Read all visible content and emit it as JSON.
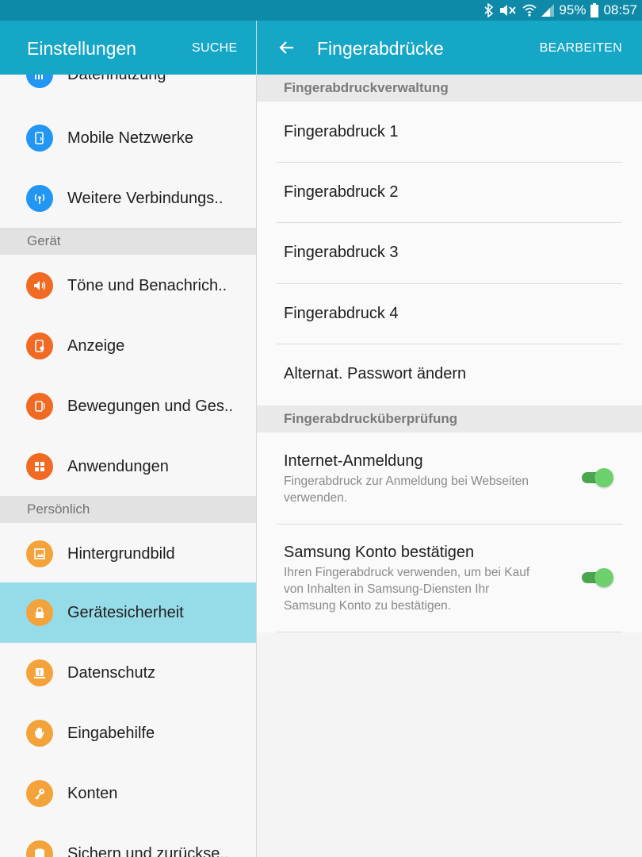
{
  "status_bar": {
    "battery": "95%",
    "time": "08:57",
    "icons": [
      "bluetooth-icon",
      "mute-icon",
      "wifi-icon",
      "signal-icon",
      "battery-icon"
    ]
  },
  "left_appbar": {
    "title": "Einstellungen",
    "search_label": "SUCHE"
  },
  "right_appbar": {
    "title": "Fingerabdrücke",
    "edit_label": "BEARBEITEN",
    "back_icon": "arrow-back-icon"
  },
  "sidebar": {
    "items_top": [
      {
        "label": "Datennutzung",
        "icon": "data-usage-icon",
        "color": "#2196f3"
      },
      {
        "label": "Mobile Netzwerke",
        "icon": "mobile-network-icon",
        "color": "#2196f3"
      },
      {
        "label": "Weitere Verbindungs..",
        "icon": "more-connections-icon",
        "color": "#2196f3"
      }
    ],
    "section_device": "Gerät",
    "items_device": [
      {
        "label": "Töne und Benachrich..",
        "icon": "sound-icon",
        "color": "#f06a23"
      },
      {
        "label": "Anzeige",
        "icon": "display-icon",
        "color": "#f06a23"
      },
      {
        "label": "Bewegungen und Ges..",
        "icon": "motion-icon",
        "color": "#f06a23"
      },
      {
        "label": "Anwendungen",
        "icon": "apps-icon",
        "color": "#f06a23"
      }
    ],
    "section_personal": "Persönlich",
    "items_personal": [
      {
        "label": "Hintergrundbild",
        "icon": "wallpaper-icon",
        "color": "#f3a33a"
      },
      {
        "label": "Gerätesicherheit",
        "icon": "lock-icon",
        "color": "#f3a33a",
        "selected": true
      },
      {
        "label": "Datenschutz",
        "icon": "privacy-icon",
        "color": "#f3a33a"
      },
      {
        "label": "Eingabehilfe",
        "icon": "hand-icon",
        "color": "#f3a33a"
      },
      {
        "label": "Konten",
        "icon": "key-icon",
        "color": "#f3a33a"
      },
      {
        "label": "Sichern und zurückse..",
        "icon": "backup-icon",
        "color": "#f3a33a"
      }
    ]
  },
  "main": {
    "section_management": "Fingerabdruckverwaltung",
    "fingerprints": [
      "Fingerabdruck 1",
      "Fingerabdruck 2",
      "Fingerabdruck 3",
      "Fingerabdruck 4"
    ],
    "alt_password": "Alternat. Passwort ändern",
    "section_verification": "Fingerabdrucküberprüfung",
    "web_login": {
      "title": "Internet-Anmeldung",
      "desc_lines": [
        "Fingerabdruck zur Anmeldung bei Webseiten",
        "verwenden."
      ],
      "enabled": true
    },
    "samsung_account": {
      "title": "Samsung Konto bestätigen",
      "desc_lines": [
        "Ihren Fingerabdruck verwenden, um bei Kauf",
        "von Inhalten in Samsung-Diensten Ihr",
        "Samsung Konto zu bestätigen."
      ],
      "enabled": true
    }
  },
  "colors": {
    "appbar": "#16a6c6",
    "statusbar": "#0e8aa8",
    "selected_row": "#96dbe8",
    "toggle_on": "#6cd06c"
  }
}
